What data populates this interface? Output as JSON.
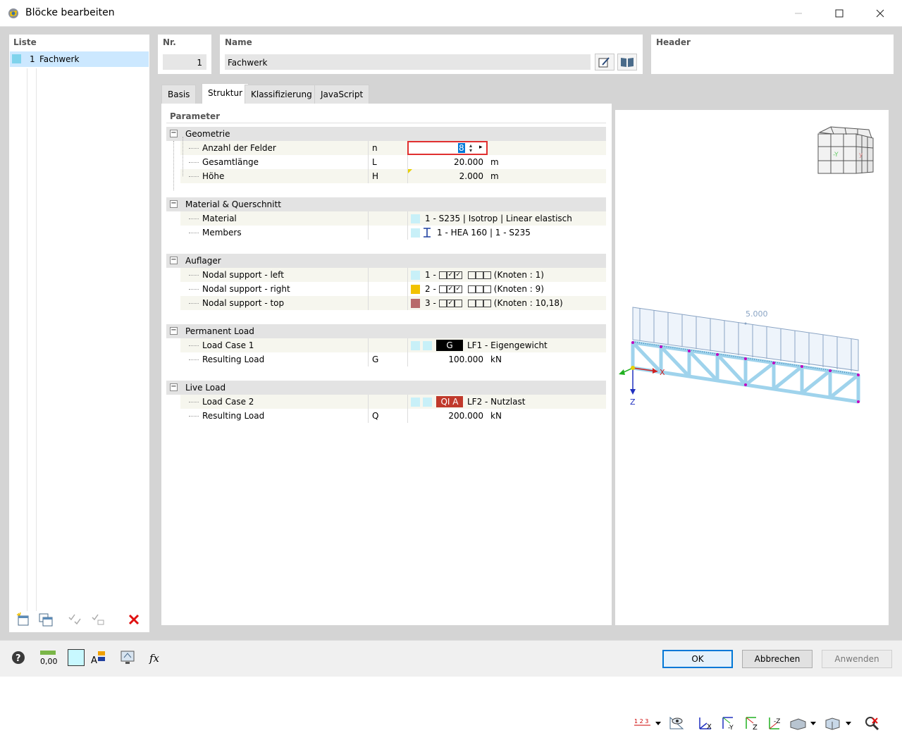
{
  "window": {
    "title": "Blöcke bearbeiten"
  },
  "list": {
    "title": "Liste",
    "items": [
      {
        "number": "1",
        "name": "Fachwerk",
        "color": "#7fd3ec"
      }
    ]
  },
  "fields": {
    "nr_label": "Nr.",
    "nr_value": "1",
    "name_label": "Name",
    "name_value": "Fachwerk",
    "header_label": "Header"
  },
  "tabs": [
    "Basis",
    "Struktur",
    "Klassifizierung",
    "JavaScript"
  ],
  "active_tab": "Struktur",
  "parameters": {
    "title": "Parameter",
    "geometrie": {
      "title": "Geometrie",
      "rows": [
        {
          "name": "Anzahl der Felder",
          "symbol": "n",
          "value": "8",
          "unit": ""
        },
        {
          "name": "Gesamtlänge",
          "symbol": "L",
          "value": "20.000",
          "unit": "m"
        },
        {
          "name": "Höhe",
          "symbol": "H",
          "value": "2.000",
          "unit": "m"
        }
      ]
    },
    "material": {
      "title": "Material & Querschnitt",
      "material_name": "Material",
      "material_value": "1 - S235 | Isotrop | Linear elastisch",
      "members_name": "Members",
      "members_value": "1 - HEA 160 | 1 - S235"
    },
    "auflager": {
      "title": "Auflager",
      "left_name": "Nodal support - left",
      "left_num": "1 -",
      "left_nodes": "(Knoten : 1)",
      "right_name": "Nodal support - right",
      "right_num": "2 -",
      "right_nodes": "(Knoten : 9)",
      "top_name": "Nodal support - top",
      "top_num": "3 -",
      "top_nodes": "(Knoten : 10,18)",
      "colors": {
        "left": "#c8f0f8",
        "right": "#f2c200",
        "top": "#b86a6a"
      }
    },
    "permanent": {
      "title": "Permanent Load",
      "lc_name": "Load Case 1",
      "lc_badge": "G",
      "lc_value": "LF1 - Eigengewicht",
      "res_name": "Resulting Load",
      "res_symbol": "G",
      "res_value": "100.000",
      "res_unit": "kN"
    },
    "live": {
      "title": "Live Load",
      "lc_name": "Load Case 2",
      "lc_badge": "QI A",
      "lc_value": "LF2 - Nutzlast",
      "res_name": "Resulting Load",
      "res_symbol": "Q",
      "res_value": "200.000",
      "res_unit": "kN"
    }
  },
  "viewport": {
    "load_label": "5.000",
    "axis_x": "X",
    "axis_z": "Z",
    "cube_y": "-Y"
  },
  "footer": {
    "ok": "OK",
    "cancel": "Abbrechen",
    "apply": "Anwenden",
    "ok_accent": "#0078d7"
  }
}
